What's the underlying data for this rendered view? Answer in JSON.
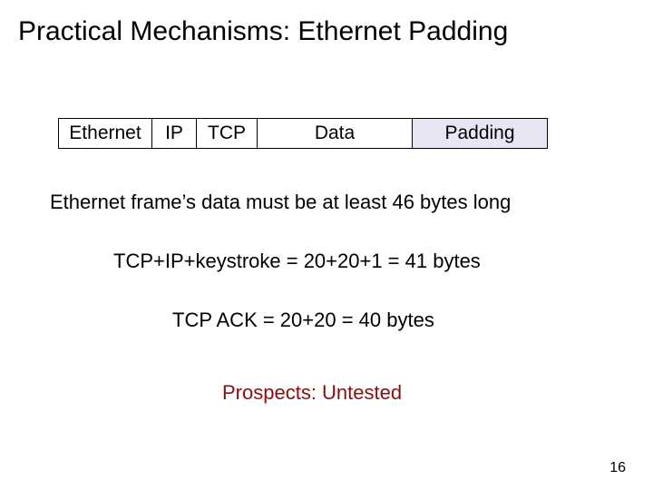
{
  "title": "Practical Mechanisms: Ethernet Padding",
  "packet": {
    "ethernet": "Ethernet",
    "ip": "IP",
    "tcp": "TCP",
    "data": "Data",
    "padding": "Padding"
  },
  "lines": {
    "frame_rule": "Ethernet frame’s data must be at least 46 bytes long",
    "calc1": "TCP+IP+keystroke = 20+20+1 = 41 bytes",
    "calc2": "TCP ACK = 20+20 = 40 bytes",
    "prospects": "Prospects:  Untested"
  },
  "page_number": "16"
}
